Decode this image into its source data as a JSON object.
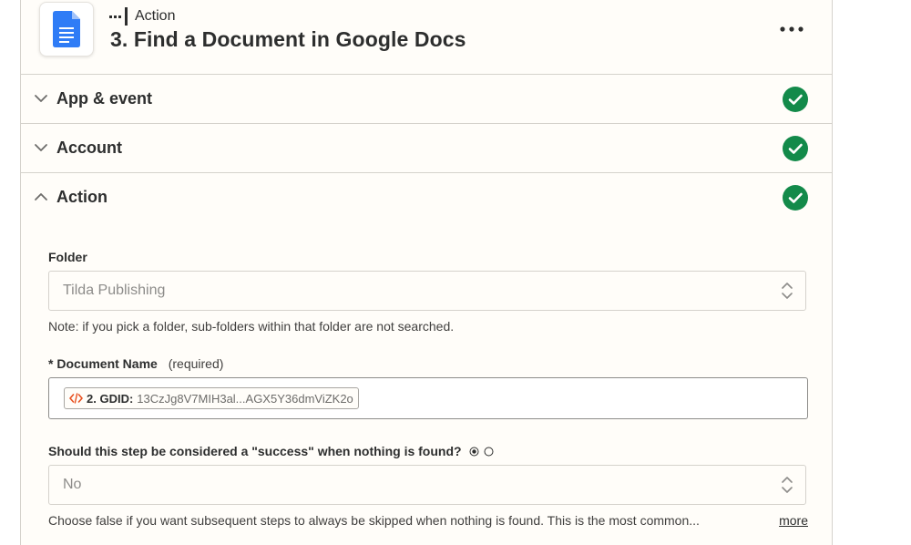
{
  "header": {
    "step_kind": "Action",
    "step_title": "3. Find a Document in Google Docs",
    "app_icon": "google-docs-icon",
    "more_icon": "more-horizontal-icon"
  },
  "sections": [
    {
      "label": "App & event",
      "state": "collapsed",
      "status": "complete"
    },
    {
      "label": "Account",
      "state": "collapsed",
      "status": "complete"
    },
    {
      "label": "Action",
      "state": "expanded",
      "status": "complete"
    }
  ],
  "form": {
    "folder": {
      "label": "Folder",
      "value": "Tilda Publishing",
      "note": "Note: if you pick a folder, sub-folders within that folder are not searched."
    },
    "document_name": {
      "required_mark": "*",
      "label": "Document Name",
      "required_text": "(required)",
      "pill_key": "2. GDID:",
      "pill_value": "13CzJg8V7MIH3al...AGX5Y36dmViZK2o"
    },
    "success_when_none": {
      "label": "Should this step be considered a \"success\" when nothing is found?",
      "value": "No",
      "help": "Choose false if you want subsequent steps to always be skipped when nothing is found. This is the most common...",
      "more_label": "more"
    }
  },
  "colors": {
    "success_green": "#138a4a",
    "docs_blue": "#2f7cf6",
    "code_pill_red": "#e8501f"
  }
}
